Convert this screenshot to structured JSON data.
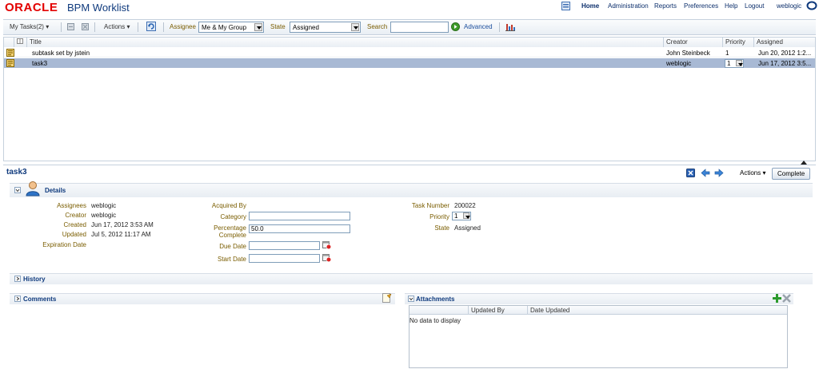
{
  "header": {
    "brand": "ORACLE",
    "app_title": "BPM Worklist",
    "links": [
      "Home",
      "Administration",
      "Reports",
      "Preferences",
      "Help",
      "Logout"
    ],
    "user": "weblogic"
  },
  "toolbar": {
    "view_label": "My Tasks(2)",
    "actions_label": "Actions",
    "assignee_label": "Assignee",
    "assignee_value": "Me & My Group",
    "state_label": "State",
    "state_value": "Assigned",
    "search_label": "Search",
    "search_value": "",
    "advanced_label": "Advanced"
  },
  "task_table": {
    "columns": [
      "Title",
      "Creator",
      "Priority",
      "Assigned"
    ],
    "rows": [
      {
        "title": "subtask set by jstein",
        "creator": "John Steinbeck",
        "priority": "1",
        "assigned": "Jun 20, 2012 1:2..."
      },
      {
        "title": "task3",
        "creator": "weblogic",
        "priority": "1",
        "assigned": "Jun 17, 2012 3:5..."
      }
    ]
  },
  "detail": {
    "title": "task3",
    "actions_label": "Actions",
    "complete_label": "Complete",
    "details_section": "Details",
    "assignees_label": "Assignees",
    "assignees_value": "weblogic",
    "creator_label": "Creator",
    "creator_value": "weblogic",
    "created_label": "Created",
    "created_value": "Jun 17, 2012 3:53 AM",
    "updated_label": "Updated",
    "updated_value": "Jul 5, 2012 11:17 AM",
    "expiration_label": "Expiration Date",
    "acquired_label": "Acquired By",
    "category_label": "Category",
    "category_value": "",
    "percentage_label_1": "Percentage",
    "percentage_label_2": "Complete",
    "percentage_value": "50.0",
    "due_label": "Due Date",
    "due_value": "",
    "start_label": "Start Date",
    "start_value": "",
    "task_number_label": "Task Number",
    "task_number_value": "200022",
    "priority_label": "Priority",
    "priority_value": "1",
    "state_label": "State",
    "state_value": "Assigned",
    "history_section": "History",
    "comments_section": "Comments",
    "attachments_section": "Attachments",
    "attachment_columns": [
      "",
      "Updated By",
      "Date Updated"
    ],
    "attachments_empty": "No data to display"
  }
}
